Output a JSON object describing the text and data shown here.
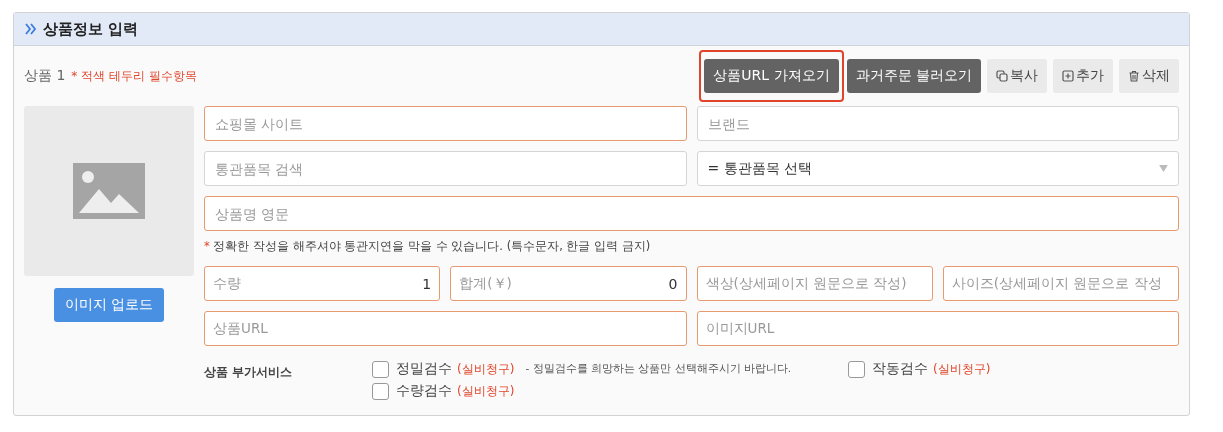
{
  "panel": {
    "title": "상품정보 입력"
  },
  "product": {
    "label": "상품 1",
    "required_mark": "*",
    "required_note": "적색 테두리 필수항목"
  },
  "actions": [
    {
      "label": "상품URL 가져오기",
      "kind": "dark",
      "highlighted": true
    },
    {
      "label": "과거주문 불러오기",
      "kind": "dark",
      "highlighted": false
    },
    {
      "label": "복사",
      "kind": "copy",
      "highlighted": false
    },
    {
      "label": "추가",
      "kind": "add",
      "highlighted": false
    },
    {
      "label": "삭제",
      "kind": "delete",
      "highlighted": false
    }
  ],
  "image_upload": {
    "button": "이미지 업로드"
  },
  "field_rows": [
    [
      {
        "placeholder": "쇼핑몰 사이트",
        "required": true,
        "kind": "text"
      },
      {
        "placeholder": "브랜드",
        "required": false,
        "kind": "text"
      }
    ],
    [
      {
        "placeholder": "통관품목 검색",
        "required": false,
        "kind": "text"
      },
      {
        "value": "= 통관품목 선택",
        "required": false,
        "kind": "select"
      }
    ],
    [
      {
        "placeholder": "상품명 영문",
        "required": true,
        "kind": "text"
      }
    ]
  ],
  "english_note": {
    "mark": "*",
    "text": "정확한 작성을 해주셔야 통관지연을 막을 수 있습니다. (특수문자, 한글 입력 금지)"
  },
  "field_rows_2": [
    [
      {
        "placeholder": "수량",
        "value": "1",
        "required": true
      },
      {
        "placeholder": "합계(￥)",
        "value": "0",
        "required": true
      },
      {
        "placeholder": "색상(상세페이지 원문으로 작성)",
        "required": true
      },
      {
        "placeholder": "사이즈(상세페이지 원문으로 작성",
        "required": true
      }
    ],
    [
      {
        "placeholder": "상품URL",
        "required": true
      },
      {
        "placeholder": "이미지URL",
        "required": true
      }
    ]
  ],
  "services": {
    "label": "상품 부가서비스",
    "items": [
      {
        "label": "정밀검수",
        "fee": "(실비청구)",
        "checked": false,
        "note": "- 정밀검수를 희망하는 상품만 선택해주시기 바랍니다."
      },
      {
        "label": "작동검수",
        "fee": "(실비청구)",
        "checked": false
      },
      {
        "label": "수량검수",
        "fee": "(실비청구)",
        "checked": false
      }
    ]
  }
}
